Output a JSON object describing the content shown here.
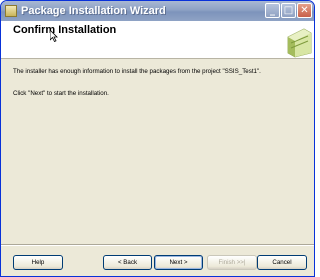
{
  "window": {
    "title": "Package Installation Wizard"
  },
  "header": {
    "title": "Confirm Installation"
  },
  "content": {
    "line1": "The installer has enough information to install the packages from the project \"SSIS_Test1\".",
    "line2": "Click \"Next\" to start the installation."
  },
  "buttons": {
    "help": "Help",
    "back": "< Back",
    "next": "Next >",
    "finish": "Finish >>|",
    "cancel": "Cancel"
  }
}
